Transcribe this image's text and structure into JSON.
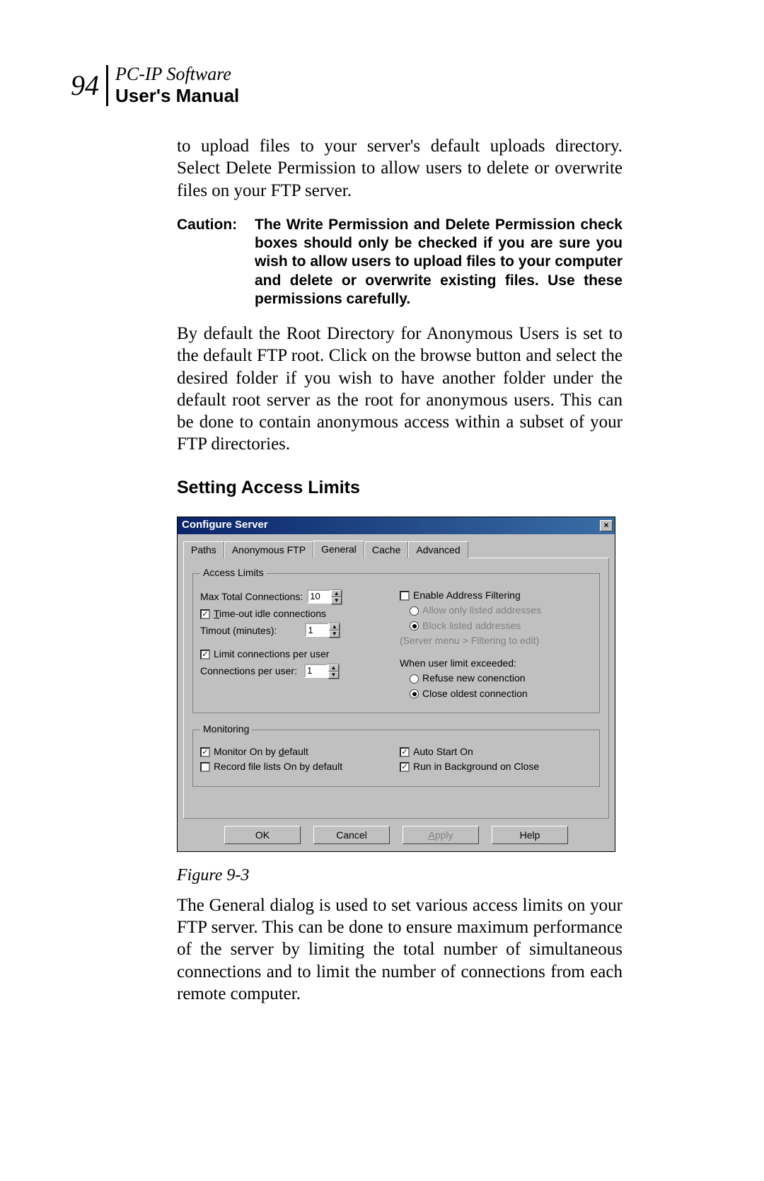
{
  "header": {
    "page_number": "94",
    "product": "PC-IP Software",
    "subtitle": "User's Manual"
  },
  "paragraphs": {
    "p1": "to upload files to your server's default uploads directory. Select Delete Permission to allow users to delete or overwrite files on your FTP server.",
    "caution_label": "Caution:",
    "caution_text": "The Write Permission and Delete Permission check boxes should only be checked if you are sure you wish to allow users to upload files to your computer and delete or overwrite existing files. Use these permissions carefully.",
    "p2": "By default the Root Directory for Anonymous Users is set to the default FTP root. Click on the browse button and select the desired folder if you wish to have another folder under the default root server as the root for anonymous users. This can be done to contain anonymous access within a subset of your FTP directories.",
    "section_heading": "Setting Access Limits",
    "figure_caption": "Figure 9-3",
    "p3": "The General dialog is used to set various access limits on your FTP server. This can be done to ensure maximum performance of the server by limiting the total number of simultaneous connections and to limit the number of connections from each remote computer."
  },
  "dialog": {
    "title": "Configure Server",
    "close_glyph": "×",
    "tabs": [
      "Paths",
      "Anonymous FTP",
      "General",
      "Cache",
      "Advanced"
    ],
    "active_tab_index": 2,
    "access_limits": {
      "legend": "Access Limits",
      "max_total_label": "Max Total Connections:",
      "max_total_value": "10",
      "timeout_idle_label": "Time-out idle connections",
      "timeout_idle_checked": true,
      "timeout_label": "Timout (minutes):",
      "timeout_value": "1",
      "limit_per_user_label": "Limit connections per user",
      "limit_per_user_checked": true,
      "conn_per_user_label": "Connections per user:",
      "conn_per_user_value": "1",
      "enable_filtering_label": "Enable Address Filtering",
      "enable_filtering_checked": false,
      "allow_only_label": "Allow only listed addresses",
      "allow_only_selected": false,
      "block_listed_label": "Block listed addresses",
      "block_listed_selected": true,
      "filtering_hint": "(Server menu > Filtering to edit)",
      "when_exceeded_label": "When user limit exceeded:",
      "refuse_label": "Refuse new conenction",
      "refuse_selected": false,
      "close_oldest_label": "Close oldest connection",
      "close_oldest_selected": true
    },
    "monitoring": {
      "legend": "Monitoring",
      "monitor_default_label": "Monitor On by default",
      "monitor_default_checked": true,
      "record_lists_label": "Record file lists On by default",
      "record_lists_checked": false,
      "auto_start_label": "Auto Start On",
      "auto_start_checked": true,
      "run_bg_label": "Run in Background on Close",
      "run_bg_checked": true
    },
    "buttons": {
      "ok": "OK",
      "cancel": "Cancel",
      "apply": "Apply",
      "help": "Help"
    }
  }
}
